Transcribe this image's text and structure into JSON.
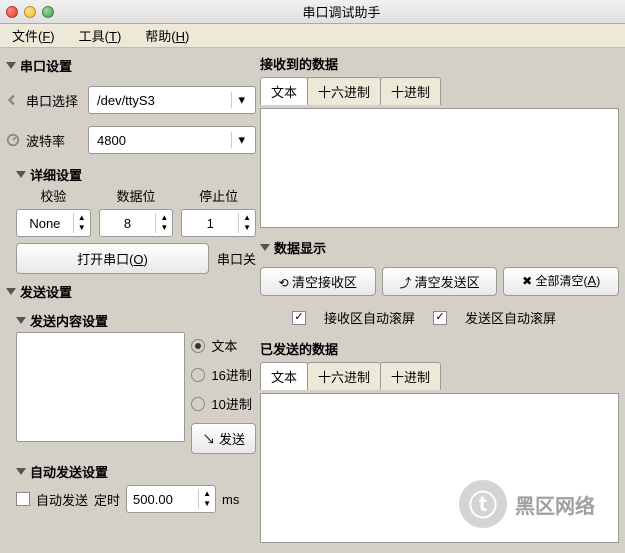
{
  "window": {
    "title": "串口调试助手"
  },
  "menu": {
    "file": "文件(F)",
    "tools": "工具(T)",
    "help": "帮助(H)"
  },
  "serial": {
    "header": "串口设置",
    "port_label": "串口选择",
    "port_value": "/dev/ttyS3",
    "baud_label": "波特率",
    "baud_value": "4800",
    "detail_header": "详细设置",
    "parity_label": "校验",
    "parity_value": "None",
    "databits_label": "数据位",
    "databits_value": "8",
    "stopbits_label": "停止位",
    "stopbits_value": "1",
    "open_btn": "打开串口(O)",
    "status": "串口关"
  },
  "send": {
    "header": "发送设置",
    "content_header": "发送内容设置",
    "radio_text": "文本",
    "radio_hex16": "16进制",
    "radio_dec10": "10进制",
    "send_btn": "发送",
    "auto_header": "自动发送设置",
    "auto_check": "自动发送",
    "timer_label": "定时",
    "timer_value": "500.00",
    "timer_unit": "ms"
  },
  "recv": {
    "header": "接收到的数据",
    "tab_text": "文本",
    "tab_hex": "十六进制",
    "tab_dec": "十进制"
  },
  "display": {
    "header": "数据显示",
    "clear_recv": "清空接收区",
    "clear_send": "清空发送区",
    "clear_all": "全部清空(A)",
    "auto_scroll_recv": "接收区自动滚屏",
    "auto_scroll_send": "发送区自动滚屏"
  },
  "sent": {
    "header": "已发送的数据",
    "tab_text": "文本",
    "tab_hex": "十六进制",
    "tab_dec": "十进制"
  },
  "watermark": "黑区网络"
}
